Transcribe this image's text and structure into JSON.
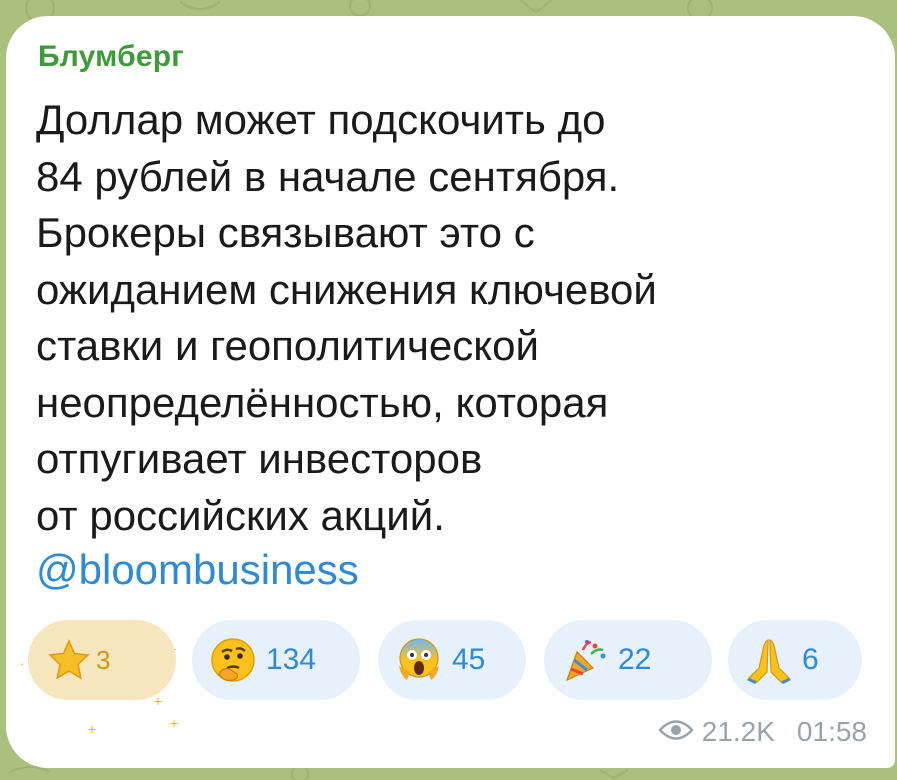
{
  "post": {
    "sender": "Блумберг",
    "lines": [
      "Доллар может подскочить до",
      "84 рублей в начале сентября.",
      "Брокеры связывают это с",
      "ожиданием снижения ключевой",
      "ставки и геополитической",
      "неопределённостью, которая",
      "отпугивает инвесторов",
      "от российских акций."
    ],
    "mention": "@bloombusiness"
  },
  "reactions": [
    {
      "emoji": "star-icon",
      "count": "3"
    },
    {
      "emoji": "thinking-face-icon",
      "count": "134"
    },
    {
      "emoji": "screaming-face-icon",
      "count": "45"
    },
    {
      "emoji": "party-popper-icon",
      "count": "22"
    },
    {
      "emoji": "folded-hands-icon",
      "count": "6"
    }
  ],
  "meta": {
    "views": "21.2K",
    "time": "01:58"
  },
  "colors": {
    "background": "#a9c07e",
    "sender": "#3f9a3a",
    "link": "#2f8ad6",
    "reaction_chip": "#e6f1fb",
    "star_chip": "#f7e6bd",
    "meta": "#9aa3ad"
  }
}
